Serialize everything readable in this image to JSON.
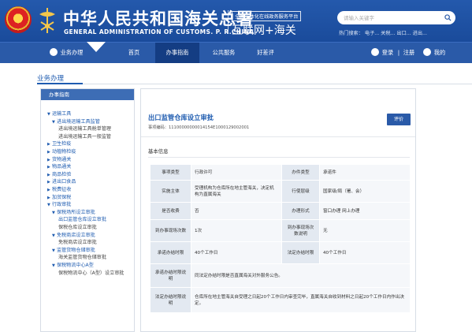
{
  "header": {
    "title_cn": "中华人民共和国海关总署",
    "title_en": "GENERAL ADMINISTRATION OF CUSTOMS. P. R.CHINA",
    "platform_small": "全国一体化在线政务服务平台",
    "platform_big": "互联网+海关",
    "search_placeholder": "请输入关键字",
    "hot_search": "热门搜索：   电子...   关税...   出口...   进出..."
  },
  "nav": {
    "business": "业务办理",
    "home": "首页",
    "guide": "办事指南",
    "public": "公共服务",
    "rate": "好差评",
    "login": "登录",
    "register": "注册",
    "mine": "我的",
    "sep": "|"
  },
  "page": {
    "section_title": "业务办理"
  },
  "sidebar": {
    "header": "办事指南",
    "items": [
      {
        "label": "运输工具",
        "toggle": "▼",
        "level": 1
      },
      {
        "label": "进出境运输工具监管",
        "toggle": "▼",
        "level": 2
      },
      {
        "label": "进出境运输工具舱单管理",
        "toggle": "",
        "level": 3
      },
      {
        "label": "进出境运输工具一般监管",
        "toggle": "",
        "level": 3
      },
      {
        "label": "卫生检疫",
        "toggle": "▶",
        "level": 1
      },
      {
        "label": "动植物检疫",
        "toggle": "▶",
        "level": 1
      },
      {
        "label": "货物通关",
        "toggle": "▶",
        "level": 1
      },
      {
        "label": "物品通关",
        "toggle": "▶",
        "level": 1
      },
      {
        "label": "商品检验",
        "toggle": "▶",
        "level": 1
      },
      {
        "label": "进出口食品",
        "toggle": "▶",
        "level": 1
      },
      {
        "label": "税费征收",
        "toggle": "▶",
        "level": 1
      },
      {
        "label": "加贸保税",
        "toggle": "▶",
        "level": 1
      },
      {
        "label": "行政审批",
        "toggle": "▼",
        "level": 1
      },
      {
        "label": "保税场所设立审批",
        "toggle": "▼",
        "level": 2
      },
      {
        "label": "出口监管仓库设立审批",
        "toggle": "",
        "level": 3,
        "selected": true
      },
      {
        "label": "保税仓库设立审批",
        "toggle": "",
        "level": 3
      },
      {
        "label": "免税商店设立审批",
        "toggle": "▼",
        "level": 2
      },
      {
        "label": "免税商店设立审批",
        "toggle": "",
        "level": 3
      },
      {
        "label": "监管货物仓储审批",
        "toggle": "▼",
        "level": 2
      },
      {
        "label": "海关监管货物仓储审批",
        "toggle": "",
        "level": 3
      },
      {
        "label": "保税物流中心A型",
        "toggle": "▼",
        "level": 2
      },
      {
        "label": "保税物流中心（A型）设立审批",
        "toggle": "",
        "level": 3
      }
    ]
  },
  "main": {
    "title": "出口监管仓库设立审批",
    "code": "事项编码：11100000000014154E1000129002001",
    "rate_button": "评价",
    "basic_info": "基本信息"
  },
  "info_table": {
    "rows": [
      {
        "l1": "事项类型",
        "v1": "行政许可",
        "l2": "办件类型",
        "v2": "承诺件"
      },
      {
        "l1": "实施主体",
        "v1": "受理机构为仓库所在地主管海关，决定机构为直属海关",
        "l2": "行使层级",
        "v2": "国家级/局（署、会）"
      },
      {
        "l1": "是否收费",
        "v1": "否",
        "l2": "办理形式",
        "v2": "窗口办理 网上办理"
      },
      {
        "l1": "到办事现场次数",
        "v1": "1次",
        "l2": "到办事现场次数说明",
        "v2": "无"
      },
      {
        "l1": "承诺办结时限",
        "v1": "40个工作日",
        "l2": "法定办结时限",
        "v2": "40个工作日"
      },
      {
        "l1": "承诺办结时限说明",
        "v1": "同法定办结时限是否直属海关对外服务公告。"
      },
      {
        "l1": "法定办结时限说明",
        "v1": "仓库所在地主管海关自受理之日起20个工作日内审查完毕，直属海关自收到材料之日起20个工作日内作出决定。"
      }
    ]
  }
}
